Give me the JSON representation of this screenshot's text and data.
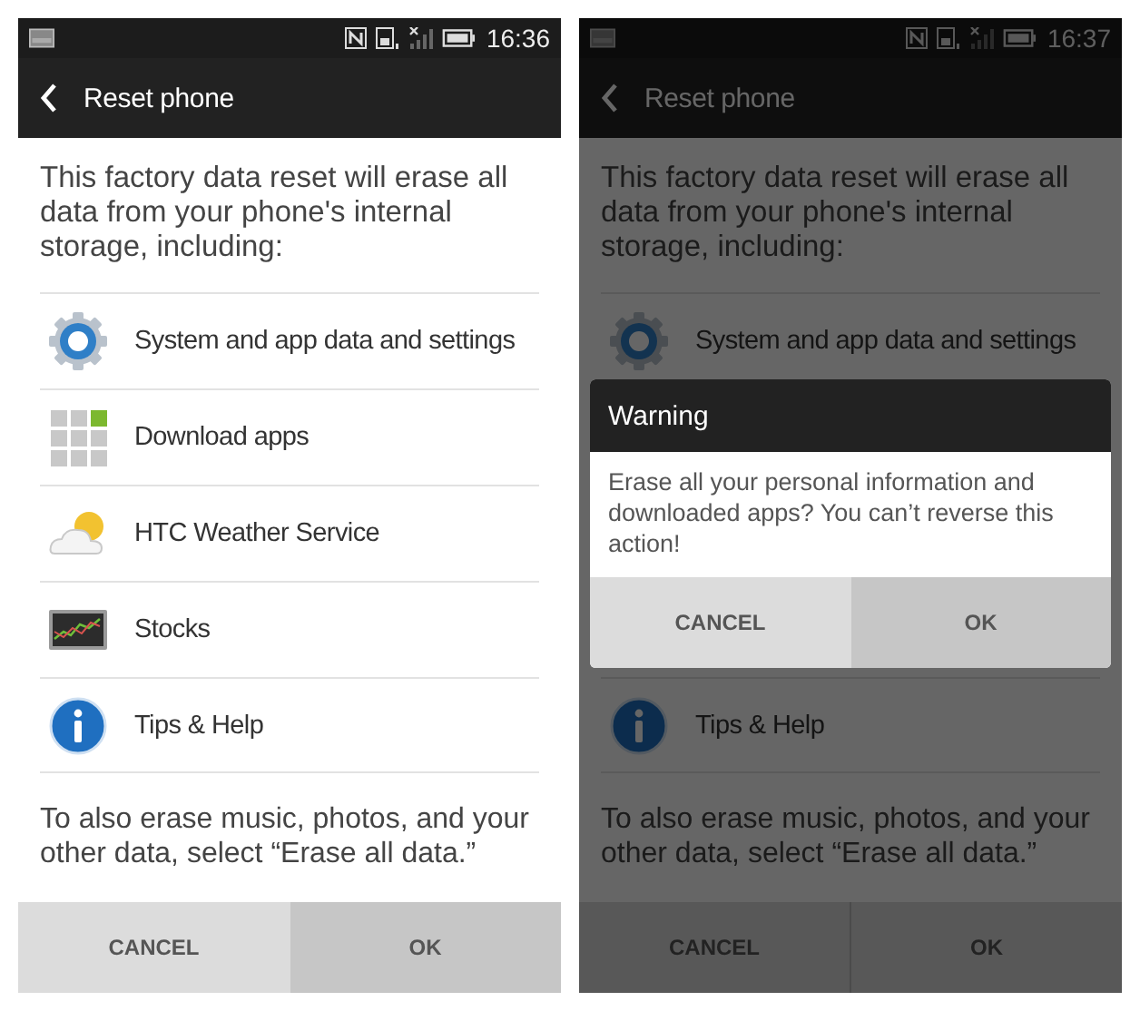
{
  "screens": [
    {
      "status_bar": {
        "time": "16:36"
      },
      "title": "Reset phone",
      "dimmed": false,
      "intro": "This factory data reset will erase all data from your phone's internal storage, including:",
      "items": [
        {
          "label": "System and app data and settings",
          "kind": "settings"
        },
        {
          "label": "Download apps",
          "kind": "apps"
        },
        {
          "label": "HTC Weather Service",
          "kind": "weather"
        },
        {
          "label": "Stocks",
          "kind": "stocks"
        },
        {
          "label": "Tips & Help",
          "kind": "info"
        }
      ],
      "note": "To also erase music, photos, and your other data, select “Erase all data.”",
      "buttons": [
        {
          "label": "CANCEL",
          "pressed": false
        },
        {
          "label": "OK",
          "pressed": true
        }
      ]
    },
    {
      "status_bar": {
        "time": "16:37"
      },
      "title": "Reset phone",
      "dimmed": true,
      "intro": "This factory data reset will erase all data from your phone's internal storage, including:",
      "items": [
        {
          "label": "System and app data and settings",
          "kind": "settings"
        },
        {
          "label": "Tips & Help",
          "kind": "info"
        }
      ],
      "dialog": {
        "title": "Warning",
        "message": "Erase all your personal information and downloaded apps? You can’t reverse this action!",
        "buttons": [
          {
            "label": "CANCEL",
            "pressed": false
          },
          {
            "label": "OK",
            "pressed": true
          }
        ]
      },
      "note": "To also erase music, photos, and your other data, select “Erase all data.”",
      "buttons": [
        {
          "label": "CANCEL"
        },
        {
          "label": "OK"
        }
      ]
    }
  ]
}
